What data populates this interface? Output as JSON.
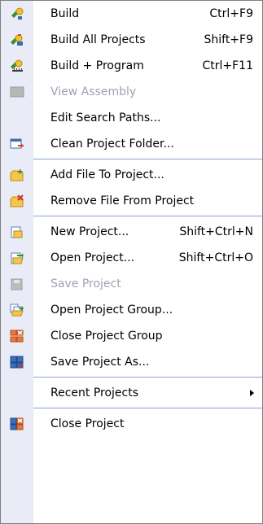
{
  "menu": {
    "items": [
      {
        "label": "Build",
        "shortcut": "Ctrl+F9",
        "disabled": false,
        "icon": "build-icon"
      },
      {
        "label": "Build All Projects",
        "shortcut": "Shift+F9",
        "disabled": false,
        "icon": "build-all-icon"
      },
      {
        "label": "Build + Program",
        "shortcut": "Ctrl+F11",
        "disabled": false,
        "icon": "build-program-icon"
      },
      {
        "label": "View Assembly",
        "shortcut": "",
        "disabled": true,
        "icon": "view-assembly-icon"
      },
      {
        "label": "Edit Search Paths...",
        "shortcut": "",
        "disabled": false,
        "icon": ""
      },
      {
        "label": "Clean Project Folder...",
        "shortcut": "",
        "disabled": false,
        "icon": "clean-folder-icon"
      },
      {
        "label": "Add File To Project...",
        "shortcut": "",
        "disabled": false,
        "icon": "add-file-icon"
      },
      {
        "label": "Remove File From Project",
        "shortcut": "",
        "disabled": false,
        "icon": "remove-file-icon"
      },
      {
        "label": "New Project...",
        "shortcut": "Shift+Ctrl+N",
        "disabled": false,
        "icon": "new-project-icon"
      },
      {
        "label": "Open Project...",
        "shortcut": "Shift+Ctrl+O",
        "disabled": false,
        "icon": "open-project-icon"
      },
      {
        "label": "Save Project",
        "shortcut": "",
        "disabled": true,
        "icon": "save-project-icon"
      },
      {
        "label": "Open Project Group...",
        "shortcut": "",
        "disabled": false,
        "icon": "open-group-icon"
      },
      {
        "label": "Close Project Group",
        "shortcut": "",
        "disabled": false,
        "icon": "close-group-icon"
      },
      {
        "label": "Save Project As...",
        "shortcut": "",
        "disabled": false,
        "icon": "save-as-icon"
      },
      {
        "label": "Recent Projects",
        "shortcut": "",
        "disabled": false,
        "icon": "",
        "submenu_arrow": "submenu-arrow-icon"
      },
      {
        "label": "Close Project",
        "shortcut": "",
        "disabled": false,
        "icon": "close-project-icon"
      }
    ]
  },
  "colors": {
    "gutter": "#e9ecf7",
    "separator": "#8aa0d7",
    "disabled_text": "#9da3b3"
  }
}
